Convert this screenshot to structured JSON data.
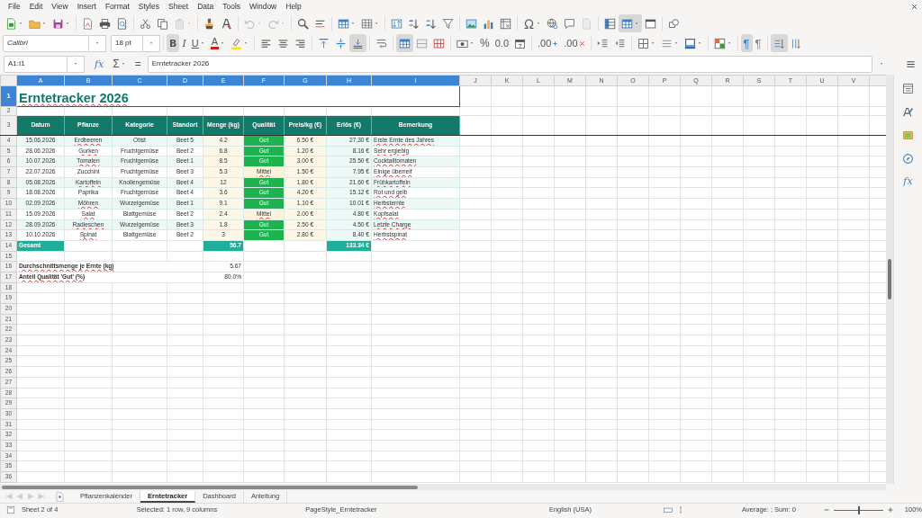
{
  "menu": [
    "File",
    "Edit",
    "View",
    "Insert",
    "Format",
    "Styles",
    "Sheet",
    "Data",
    "Tools",
    "Window",
    "Help"
  ],
  "standard_toolbar": [
    {
      "kind": "new",
      "pressed": false,
      "disabled": false
    },
    {
      "kind": "open",
      "pressed": false,
      "disabled": false
    },
    {
      "kind": "save",
      "pressed": false,
      "disabled": false
    },
    {
      "kind": "pdf",
      "pressed": false,
      "disabled": false
    },
    {
      "kind": "print",
      "pressed": false,
      "disabled": false
    },
    {
      "kind": "preview",
      "pressed": false,
      "disabled": false
    },
    {
      "kind": "cut",
      "pressed": false,
      "disabled": false
    },
    {
      "kind": "copy",
      "pressed": false,
      "disabled": false
    },
    {
      "kind": "paste",
      "pressed": false,
      "disabled": true
    },
    {
      "kind": "clone",
      "pressed": false,
      "disabled": false
    },
    {
      "kind": "clear",
      "pressed": false,
      "disabled": false
    },
    {
      "kind": "undo",
      "pressed": false,
      "disabled": true
    },
    {
      "kind": "redo",
      "pressed": false,
      "disabled": true
    },
    {
      "kind": "find",
      "pressed": false,
      "disabled": false
    },
    {
      "kind": "spell",
      "pressed": false,
      "disabled": false
    },
    {
      "kind": "rows",
      "pressed": false,
      "disabled": false
    },
    {
      "kind": "cols",
      "pressed": false,
      "disabled": false
    },
    {
      "kind": "sort",
      "pressed": false,
      "disabled": false
    },
    {
      "kind": "asc",
      "pressed": false,
      "disabled": false
    },
    {
      "kind": "desc",
      "pressed": false,
      "disabled": false
    },
    {
      "kind": "filter",
      "pressed": false,
      "disabled": false
    },
    {
      "kind": "image",
      "pressed": false,
      "disabled": false
    },
    {
      "kind": "chart",
      "pressed": false,
      "disabled": false
    },
    {
      "kind": "pivot",
      "pressed": false,
      "disabled": false
    },
    {
      "kind": "special",
      "pressed": false,
      "disabled": false
    },
    {
      "kind": "link",
      "pressed": false,
      "disabled": false
    },
    {
      "kind": "comment",
      "pressed": false,
      "disabled": false
    },
    {
      "kind": "header",
      "pressed": false,
      "disabled": true
    },
    {
      "kind": "freeze",
      "pressed": false,
      "disabled": false
    },
    {
      "kind": "split",
      "pressed": true,
      "disabled": false
    },
    {
      "kind": "window",
      "pressed": false,
      "disabled": false
    },
    {
      "kind": "shapes",
      "pressed": false,
      "disabled": false
    }
  ],
  "font_name": "Calibri",
  "font_size": "18 pt",
  "formatting_toolbar": [
    {
      "kind": "bold",
      "label": "B",
      "pressed": true
    },
    {
      "kind": "italic",
      "label": "I",
      "pressed": false
    },
    {
      "kind": "underline",
      "label": "U",
      "pressed": false
    },
    {
      "kind": "fontcolor",
      "label": "A",
      "pressed": false
    },
    {
      "kind": "highlight",
      "pressed": false
    },
    {
      "kind": "align_left",
      "pressed": false
    },
    {
      "kind": "align_center",
      "pressed": false
    },
    {
      "kind": "align_right",
      "pressed": false
    },
    {
      "kind": "valign_top",
      "pressed": false
    },
    {
      "kind": "valign_center",
      "pressed": false
    },
    {
      "kind": "valign_bottom",
      "pressed": true
    },
    {
      "kind": "wrap",
      "pressed": false
    },
    {
      "kind": "merge_center",
      "pressed": true
    },
    {
      "kind": "merge",
      "pressed": false
    },
    {
      "kind": "unmerge",
      "pressed": false
    },
    {
      "kind": "currency",
      "pressed": false
    },
    {
      "kind": "percent",
      "label": "%",
      "pressed": false
    },
    {
      "kind": "number",
      "label": "0.0",
      "pressed": false
    },
    {
      "kind": "date",
      "pressed": false
    },
    {
      "kind": "add_decimal",
      "label": ".00",
      "pressed": false
    },
    {
      "kind": "del_decimal",
      "label": ".00",
      "pressed": false
    },
    {
      "kind": "indent",
      "pressed": false
    },
    {
      "kind": "outdent",
      "pressed": false
    },
    {
      "kind": "borders",
      "pressed": false
    },
    {
      "kind": "border_style",
      "pressed": false
    },
    {
      "kind": "border_color",
      "pressed": false
    },
    {
      "kind": "conditional",
      "pressed": false
    },
    {
      "kind": "ltr",
      "label": "¶",
      "pressed": true
    },
    {
      "kind": "rtl",
      "label": "¶",
      "pressed": false
    },
    {
      "kind": "stacked",
      "pressed": true
    },
    {
      "kind": "vertical",
      "pressed": false
    }
  ],
  "formula_bar": {
    "name_box": "A1:I1",
    "function_wizard": "fx",
    "sum": "Σ",
    "equals": "=",
    "content": "Erntetracker 2026"
  },
  "sidebar": [
    {
      "kind": "properties"
    },
    {
      "kind": "styles"
    },
    {
      "kind": "gallery"
    },
    {
      "kind": "navigator"
    },
    {
      "kind": "functions",
      "label": "fx"
    }
  ],
  "columns": [
    {
      "label": "A",
      "selected": true
    },
    {
      "label": "B",
      "selected": true
    },
    {
      "label": "C",
      "selected": true
    },
    {
      "label": "D",
      "selected": true
    },
    {
      "label": "E",
      "selected": true
    },
    {
      "label": "F",
      "selected": true
    },
    {
      "label": "G",
      "selected": true
    },
    {
      "label": "H",
      "selected": true
    },
    {
      "label": "I",
      "selected": true
    },
    {
      "label": "J",
      "selected": false
    },
    {
      "label": "K",
      "selected": false
    },
    {
      "label": "L",
      "selected": false
    },
    {
      "label": "M",
      "selected": false
    },
    {
      "label": "N",
      "selected": false
    },
    {
      "label": "O",
      "selected": false
    },
    {
      "label": "P",
      "selected": false
    },
    {
      "label": "Q",
      "selected": false
    },
    {
      "label": "R",
      "selected": false
    },
    {
      "label": "S",
      "selected": false
    },
    {
      "label": "T",
      "selected": false
    },
    {
      "label": "U",
      "selected": false
    },
    {
      "label": "V",
      "selected": false
    }
  ],
  "rows": [
    {
      "label": "1",
      "selected": true
    },
    {
      "label": "2",
      "selected": false
    },
    {
      "label": "3",
      "selected": false
    },
    {
      "label": "4",
      "selected": false
    },
    {
      "label": "5",
      "selected": false
    },
    {
      "label": "6",
      "selected": false
    },
    {
      "label": "7",
      "selected": false
    },
    {
      "label": "8",
      "selected": false
    },
    {
      "label": "9",
      "selected": false
    },
    {
      "label": "10",
      "selected": false
    },
    {
      "label": "11",
      "selected": false
    },
    {
      "label": "12",
      "selected": false
    },
    {
      "label": "13",
      "selected": false
    },
    {
      "label": "14",
      "selected": false
    },
    {
      "label": "15",
      "selected": false
    },
    {
      "label": "16",
      "selected": false
    },
    {
      "label": "17",
      "selected": false
    },
    {
      "label": "18",
      "selected": false
    },
    {
      "label": "19",
      "selected": false
    },
    {
      "label": "20",
      "selected": false
    },
    {
      "label": "21",
      "selected": false
    },
    {
      "label": "22",
      "selected": false
    },
    {
      "label": "23",
      "selected": false
    },
    {
      "label": "24",
      "selected": false
    },
    {
      "label": "25",
      "selected": false
    },
    {
      "label": "26",
      "selected": false
    },
    {
      "label": "27",
      "selected": false
    },
    {
      "label": "28",
      "selected": false
    },
    {
      "label": "29",
      "selected": false
    },
    {
      "label": "30",
      "selected": false
    },
    {
      "label": "31",
      "selected": false
    },
    {
      "label": "32",
      "selected": false
    },
    {
      "label": "33",
      "selected": false
    },
    {
      "label": "34",
      "selected": false
    },
    {
      "label": "35",
      "selected": false
    },
    {
      "label": "36",
      "selected": false
    }
  ],
  "title": "Erntetracker 2026",
  "title_spell_error": true,
  "table_headers": [
    "Datum",
    "Pflanze",
    "Kategorie",
    "Standort",
    "Menge (kg)",
    "Qualität",
    "Preis/kg (€)",
    "Erlös (€)",
    "Bemerkung"
  ],
  "entries": [
    {
      "date": "15.06.2026",
      "plant": {
        "text": "Erdbeeren",
        "spell_error": true
      },
      "category": "Obst",
      "bed": "Beet 5",
      "amount": "4.2",
      "quality": {
        "text": "Gut",
        "color": "#1fb251",
        "spell_error": false
      },
      "price": "6.50 €",
      "revenue": "27.30 €",
      "note": {
        "text": "Erste Ernte des Jahres",
        "spell_error": true
      }
    },
    {
      "date": "28.06.2026",
      "plant": {
        "text": "Gurken",
        "spell_error": true
      },
      "category": "Fruchtgemüse",
      "bed": "Beet 2",
      "amount": "6.8",
      "quality": {
        "text": "Gut",
        "color": "#1fb251",
        "spell_error": false
      },
      "price": "1.20 €",
      "revenue": "8.16 €",
      "note": {
        "text": "Sehr ergiebig",
        "spell_error": true
      }
    },
    {
      "date": "10.07.2026",
      "plant": {
        "text": "Tomaten",
        "spell_error": true
      },
      "category": "Fruchtgemüse",
      "bed": "Beet 1",
      "amount": "8.5",
      "quality": {
        "text": "Gut",
        "color": "#1fb251",
        "spell_error": false
      },
      "price": "3.00 €",
      "revenue": "25.50 €",
      "note": {
        "text": "Cocktailtomaten",
        "spell_error": true
      }
    },
    {
      "date": "22.07.2026",
      "plant": {
        "text": "Zucchini",
        "spell_error": false
      },
      "category": "Fruchtgemüse",
      "bed": "Beet 3",
      "amount": "5.3",
      "quality": {
        "text": "Mittel",
        "color": "#fdf3dc",
        "spell_error": true
      },
      "price": "1.50 €",
      "revenue": "7.95 €",
      "note": {
        "text": "Einige überreif",
        "spell_error": true
      }
    },
    {
      "date": "05.08.2026",
      "plant": {
        "text": "Kartoffeln",
        "spell_error": true
      },
      "category": "Knollengemüse",
      "bed": "Beet 4",
      "amount": "12",
      "quality": {
        "text": "Gut",
        "color": "#1fb251",
        "spell_error": false
      },
      "price": "1.80 €",
      "revenue": "21.60 €",
      "note": {
        "text": "Frühkartoffeln",
        "spell_error": true
      }
    },
    {
      "date": "18.08.2026",
      "plant": {
        "text": "Paprika",
        "spell_error": false
      },
      "category": "Fruchtgemüse",
      "bed": "Beet 4",
      "amount": "3.6",
      "quality": {
        "text": "Gut",
        "color": "#1fb251",
        "spell_error": false
      },
      "price": "4.20 €",
      "revenue": "15.12 €",
      "note": {
        "text": "Rot und gelb",
        "spell_error": true
      }
    },
    {
      "date": "02.09.2026",
      "plant": {
        "text": "Möhren",
        "spell_error": true
      },
      "category": "Wurzelgemüse",
      "bed": "Beet 1",
      "amount": "9.1",
      "quality": {
        "text": "Gut",
        "color": "#1fb251",
        "spell_error": false
      },
      "price": "1.10 €",
      "revenue": "10.01 €",
      "note": {
        "text": "Herbsternte",
        "spell_error": true
      }
    },
    {
      "date": "15.09.2026",
      "plant": {
        "text": "Salat",
        "spell_error": true
      },
      "category": "Blattgemüse",
      "bed": "Beet 2",
      "amount": "2.4",
      "quality": {
        "text": "Mittel",
        "color": "#fdf3dc",
        "spell_error": true
      },
      "price": "2.00 €",
      "revenue": "4.80 €",
      "note": {
        "text": "Kopfsalat",
        "spell_error": true
      }
    },
    {
      "date": "28.09.2026",
      "plant": {
        "text": "Radieschen",
        "spell_error": true
      },
      "category": "Wurzelgemüse",
      "bed": "Beet 3",
      "amount": "1.8",
      "quality": {
        "text": "Gut",
        "color": "#1fb251",
        "spell_error": false
      },
      "price": "2.50 €",
      "revenue": "4.50 €",
      "note": {
        "text": "Letzte Charge",
        "spell_error": true
      }
    },
    {
      "date": "10.10.2026",
      "plant": {
        "text": "Spinat",
        "spell_error": true
      },
      "category": "Blattgemüse",
      "bed": "Beet 2",
      "amount": "3",
      "quality": {
        "text": "Gut",
        "color": "#1fb251",
        "spell_error": false
      },
      "price": "2.80 €",
      "revenue": "8.40 €",
      "note": {
        "text": "Herbstspinat",
        "spell_error": true
      }
    }
  ],
  "total": {
    "label": "Gesamt",
    "amount": "56.7",
    "revenue": "133.34 €"
  },
  "summary": [
    {
      "label": "Durchschnittsmenge je Ernte (kg)",
      "value": "5.67",
      "spell_error": true
    },
    {
      "label": "Anteil Qualität 'Gut' (%)",
      "value": "80.0%",
      "spell_error": true
    }
  ],
  "sheet_tabs": [
    {
      "label": "Pflanzenkalender",
      "selected": false
    },
    {
      "label": "Erntetracker",
      "selected": true
    },
    {
      "label": "Dashboard",
      "selected": false
    },
    {
      "label": "Anleitung",
      "selected": false
    }
  ],
  "status_bar": {
    "sheet": "Sheet 2 of 4",
    "selection": "Selected: 1 row, 9 columns",
    "page_style": "PageStyle_Erntetracker",
    "language": "English (USA)",
    "aggregate": "Average: ; Sum: 0",
    "zoom": "100%",
    "zoom_slider": {
      "level": 0.5
    }
  }
}
